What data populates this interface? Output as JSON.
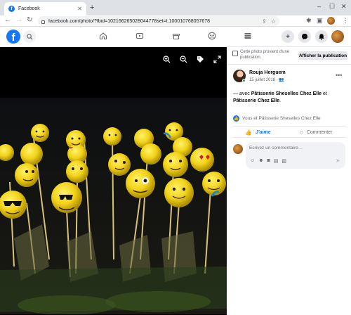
{
  "browser": {
    "tab_title": "Facebook",
    "tab_favicon": "f",
    "new_tab": "+",
    "url": "facebook.com/photo/?fbid=102166265028044778set=t.100010768057678",
    "controls": {
      "minimize": "–",
      "maximize": "☐",
      "close": "✕"
    }
  },
  "fb_header": {
    "logo": "f",
    "nav_icons": [
      "home-icon",
      "watch-icon",
      "marketplace-icon",
      "groups-icon",
      "menu-icon"
    ],
    "right_icons": [
      "create-icon",
      "messenger-icon",
      "notifications-icon",
      "account-avatar"
    ]
  },
  "viewer": {
    "tools": [
      "zoom-in-icon",
      "zoom-out-icon",
      "tag-icon",
      "fullscreen-icon"
    ]
  },
  "notice": {
    "text": "Cette photo provient d'une publication.",
    "button": "Afficher la publication"
  },
  "post": {
    "author": "Rouja Herguem",
    "date": "15 juillet 2018 ·",
    "text_prefix": "— avec ",
    "tag1": "Pâtisserie Sheselles Chez Elle",
    "text_mid": " et ",
    "tag2": "Pâtisserie Chez Elle",
    "text_suffix": ".",
    "reactions_text": "Vous et Pâtisserie Sheselles Chez Elle",
    "like_label": "J'aime",
    "comment_label": "Commenter",
    "comment_placeholder": "Écrivez un commentaire…"
  },
  "colors": {
    "accent": "#1877f2",
    "online": "#31a24c"
  }
}
